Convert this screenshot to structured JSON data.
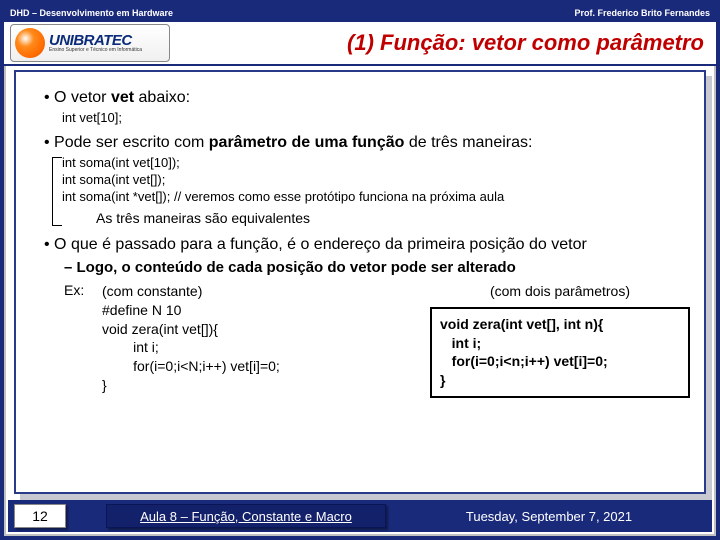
{
  "header": {
    "left": "DHD – Desenvolvimento em Hardware",
    "right": "Prof. Frederico Brito Fernandes",
    "logo_main": "UNIBRATEC",
    "logo_sub": "Ensino Superior e Técnico em Informática"
  },
  "title": "(1) Função: vetor como parâmetro",
  "body": {
    "b1_pre": "O vetor ",
    "b1_bold": "vet",
    "b1_post": " abaixo:",
    "code1": "int vet[10];",
    "b2_pre": "Pode ser escrito com ",
    "b2_bold": "parâmetro de uma função",
    "b2_post": " de três maneiras:",
    "proto1": "int soma(int vet[10]);",
    "proto2": "int soma(int vet[]);",
    "proto3": "int soma(int *vet[]); // veremos como esse protótipo funciona na próxima aula",
    "equiv": "As três maneiras são equivalentes",
    "b3": "O que é passado para a função, é o endereço da primeira posição do vetor",
    "sub": "Logo, o conteúdo de cada posição do vetor pode ser alterado",
    "ex_label": "Ex:",
    "left_hdr": "(com constante)",
    "left_l1": "#define N 10",
    "left_l2": "void zera(int vet[]){",
    "left_l3": "        int i;",
    "left_l4": "        for(i=0;i<N;i++) vet[i]=0;",
    "left_l5": "}",
    "right_hdr": "(com dois parâmetros)",
    "box_l1": "void zera(int vet[], int n){",
    "box_l2": "   int i;",
    "box_l3": "   for(i=0;i<n;i++) vet[i]=0;",
    "box_l4": "}"
  },
  "footer": {
    "slide": "12",
    "lesson": "Aula 8 – Função, Constante e Macro",
    "date": "Tuesday, September 7, 2021"
  }
}
